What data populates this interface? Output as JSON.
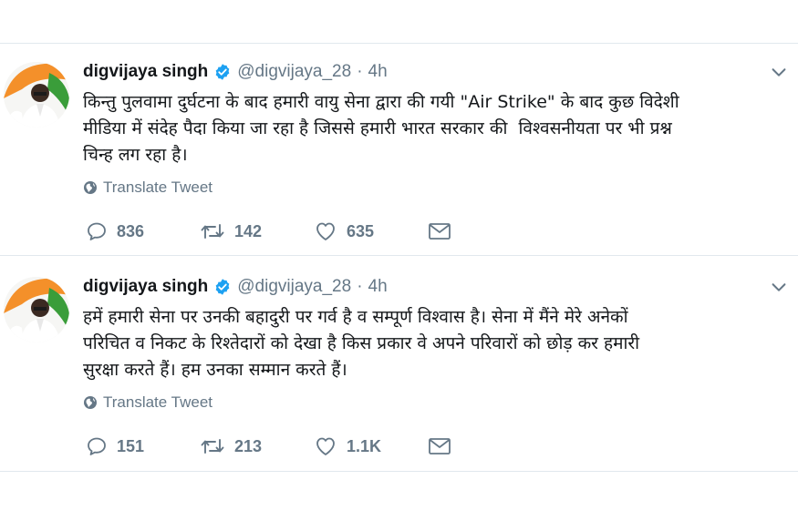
{
  "tweets": [
    {
      "author_name": "digvijaya singh",
      "handle": "@digvijaya_28",
      "separator": "·",
      "time": "4h",
      "text": "किन्तु पुलवामा दुर्घटना के बाद हमारी वायु सेना द्वारा की गयी \"Air Strike\" के बाद कुछ विदेशी\nमीडिया में संदेह पैदा किया जा रहा है जिससे हमारी भारत सरकार की  विश्वसनीयता पर भी प्रश्न\nचिन्ह लग रहा है।",
      "translate_label": "Translate Tweet",
      "replies": "836",
      "retweets": "142",
      "likes": "635",
      "icons": {
        "reply": "reply-icon",
        "retweet": "retweet-icon",
        "like": "heart-icon",
        "dm": "envelope-icon",
        "caret": "chevron-down-icon",
        "verified": "verified-badge-icon",
        "globe": "globe-icon"
      }
    },
    {
      "author_name": "digvijaya singh",
      "handle": "@digvijaya_28",
      "separator": "·",
      "time": "4h",
      "text": "हमें हमारी सेना पर उनकी बहादुरी पर गर्व है व सम्पूर्ण विश्वास है। सेना में मैंने मेरे अनेकों\nपरिचित व निकट के रिश्तेदारों को देखा है किस प्रकार वे अपने परिवारों को छोड़ कर हमारी\nसुरक्षा करते हैं। हम उनका सम्मान करते हैं।",
      "translate_label": "Translate Tweet",
      "replies": "151",
      "retweets": "213",
      "likes": "1.1K",
      "icons": {
        "reply": "reply-icon",
        "retweet": "retweet-icon",
        "like": "heart-icon",
        "dm": "envelope-icon",
        "caret": "chevron-down-icon",
        "verified": "verified-badge-icon",
        "globe": "globe-icon"
      }
    }
  ],
  "colors": {
    "text_primary": "#14171a",
    "text_secondary": "#657786",
    "verified_blue": "#1da1f2",
    "divider": "#e1e8ed",
    "avatar_orange": "#f4902a",
    "avatar_green": "#3a9d3a"
  }
}
